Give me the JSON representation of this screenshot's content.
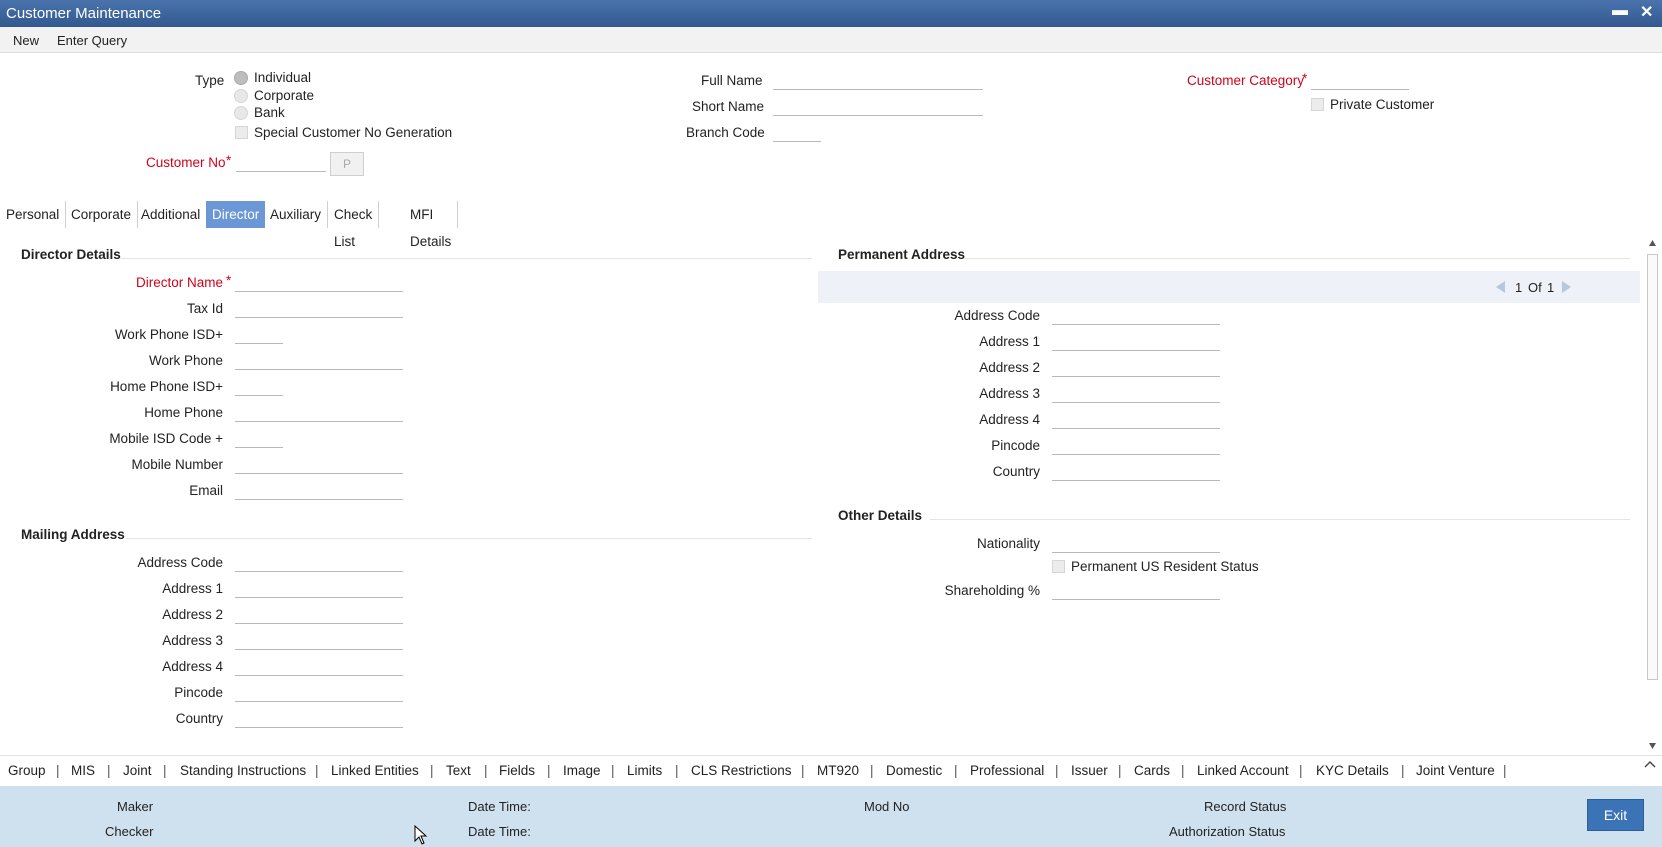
{
  "window": {
    "title": "Customer Maintenance",
    "minimize_glyph": "▬",
    "close_glyph": "✕"
  },
  "menu": {
    "new": "New",
    "enter_query": "Enter Query"
  },
  "header": {
    "type_label": "Type",
    "type_options": [
      "Individual",
      "Corporate",
      "Bank"
    ],
    "type_selected": "Individual",
    "special_no_gen": "Special Customer No Generation",
    "customer_no_label": "Customer No",
    "required_mark": "*",
    "p_button": "P",
    "full_name_label": "Full Name",
    "short_name_label": "Short Name",
    "branch_code_label": "Branch Code",
    "customer_category_label": "Customer Category",
    "private_customer": "Private Customer"
  },
  "tabs": [
    "Personal",
    "Corporate",
    "Additional",
    "Director",
    "Auxiliary",
    "Check List",
    "MFI Details"
  ],
  "active_tab": "Director",
  "director": {
    "heading": "Director Details",
    "fields": [
      "Director Name",
      "Tax Id",
      "Work Phone ISD+",
      "Work Phone",
      "Home Phone ISD+",
      "Home Phone",
      "Mobile ISD Code +",
      "Mobile Number",
      "Email"
    ]
  },
  "mailing": {
    "heading": "Mailing Address",
    "fields": [
      "Address Code",
      "Address 1",
      "Address 2",
      "Address 3",
      "Address 4",
      "Pincode",
      "Country"
    ]
  },
  "permanent": {
    "heading": "Permanent Address",
    "pager": {
      "current": "1",
      "of": "Of",
      "total": "1"
    },
    "fields": [
      "Address Code",
      "Address 1",
      "Address 2",
      "Address 3",
      "Address 4",
      "Pincode",
      "Country"
    ]
  },
  "other": {
    "heading": "Other Details",
    "nationality": "Nationality",
    "us_resident": "Permanent US Resident Status",
    "shareholding": "Shareholding %"
  },
  "links": [
    "Group",
    "MIS",
    "Joint",
    "Standing Instructions",
    "Linked Entities",
    "Text",
    "Fields",
    "Image",
    "Limits",
    "CLS Restrictions",
    "MT920",
    "Domestic",
    "Professional",
    "Issuer",
    "Cards",
    "Linked Account",
    "KYC Details",
    "Joint Venture"
  ],
  "footer": {
    "maker": "Maker",
    "checker": "Checker",
    "date_time": "Date Time:",
    "mod_no": "Mod No",
    "record_status": "Record Status",
    "authorization_status": "Authorization Status",
    "exit": "Exit"
  }
}
